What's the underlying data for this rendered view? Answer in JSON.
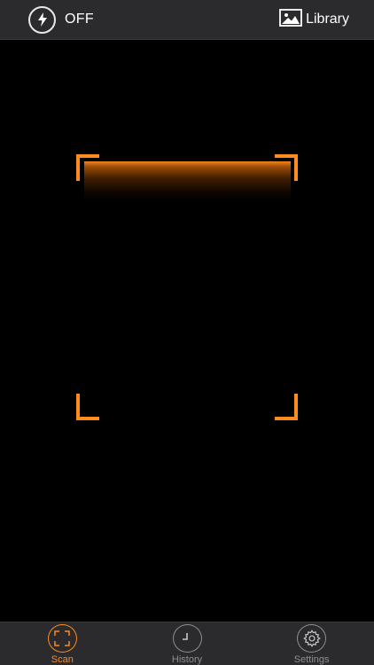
{
  "topbar": {
    "flash": {
      "icon": "flash-icon",
      "state_label": "OFF"
    },
    "library": {
      "icon": "photo-library-icon",
      "label": "Library"
    }
  },
  "scanner": {
    "frame_color": "#ff8a1e",
    "corner_icon": "scan-frame-corner"
  },
  "tabbar": {
    "active_color": "#ff8a1e",
    "inactive_color": "#8e8e93",
    "tabs": [
      {
        "label": "Scan",
        "icon": "scan-icon",
        "active": true
      },
      {
        "label": "History",
        "icon": "clock-icon",
        "active": false
      },
      {
        "label": "Settings",
        "icon": "gear-icon",
        "active": false
      }
    ]
  }
}
